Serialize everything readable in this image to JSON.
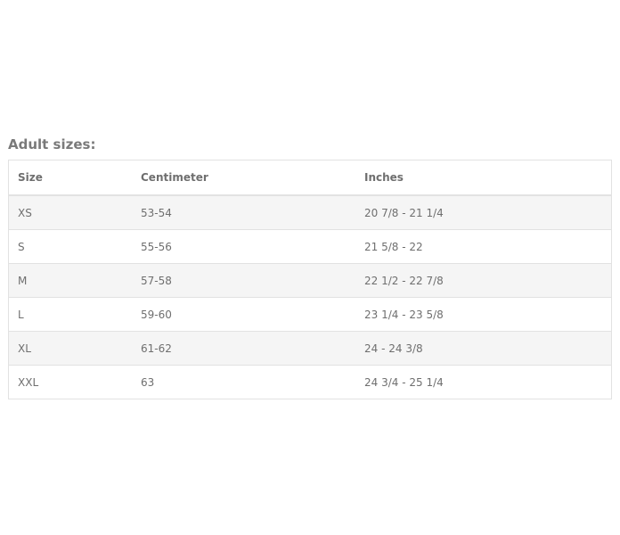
{
  "title": "Adult sizes:",
  "table": {
    "headers": [
      "Size",
      "Centimeter",
      "Inches"
    ],
    "rows": [
      [
        "XS",
        "53-54",
        "20 7/8 - 21 1/4"
      ],
      [
        "S",
        "55-56",
        "21 5/8 - 22"
      ],
      [
        "M",
        "57-58",
        "22 1/2 - 22 7/8"
      ],
      [
        "L",
        "59-60",
        "23 1/4 - 23 5/8"
      ],
      [
        "XL",
        "61-62",
        "24 - 24 3/8"
      ],
      [
        "XXL",
        "63",
        "24 3/4 - 25 1/4"
      ]
    ]
  },
  "colors": {
    "text": "#6f6f6f",
    "stripe": "#f5f5f5",
    "border": "#e2e2e2"
  }
}
